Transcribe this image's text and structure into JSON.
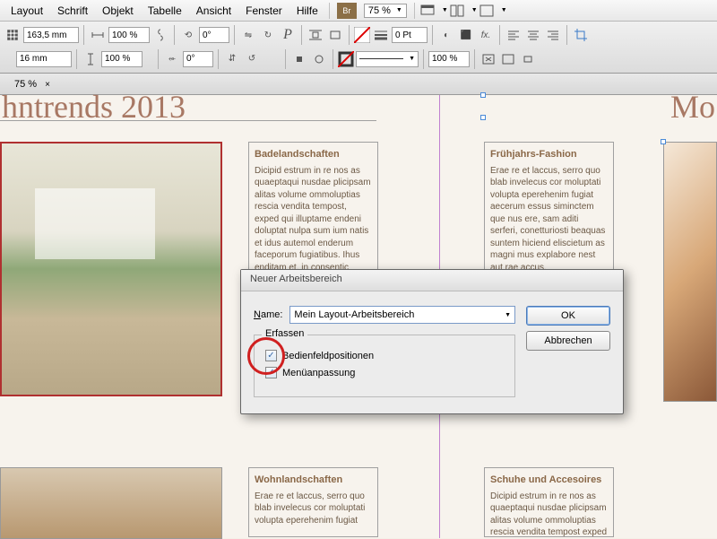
{
  "menubar": {
    "items": [
      "Layout",
      "Schrift",
      "Objekt",
      "Tabelle",
      "Ansicht",
      "Fenster",
      "Hilfe"
    ],
    "br_label": "Br",
    "zoom": "75 %"
  },
  "toolbar": {
    "x_field": "163,5 mm",
    "y_field": "16 mm",
    "pct_a": "100 %",
    "pct_b": "100 %",
    "deg_a": "0°",
    "deg_b": "0°",
    "p_icon": "P",
    "stroke_pt": "0 Pt",
    "fx_label": "fx.",
    "pct_c": "100 %",
    "pct_d": "100 %"
  },
  "tabs": {
    "zoom_tab": "75 %"
  },
  "canvas": {
    "title_left": "hntrends 2013",
    "title_right": "Mo",
    "blocks": {
      "bade": {
        "heading": "Badelandschaften",
        "body": "Dicipid estrum in re nos as quaeptaqui nusdae plicipsam alitas volume ommoluptias rescia vendita tempost, exped qui illuptame endeni doluptat nulpa sum ium natis et idus autemol enderum faceporum fugiatibus.\nIhus enditam et, in consentic"
      },
      "fruh": {
        "heading": "Frühjahrs-Fashion",
        "body": "Erae re et laccus, serro quo blab invelecus cor moluptati volupta eperehenim fugiat aecerum essus siminctem que nus ere, sam aditi serferi, conetturiosti beaquas suntem hiciend eliscietum as magni mus explabore nest aut rae accus."
      },
      "wohn": {
        "heading": "Wohnlandschaften",
        "body": "Erae re et laccus, serro quo blab invelecus cor moluptati volupta eperehenim fugiat"
      },
      "schuhe": {
        "heading": "Schuhe und Accesoires",
        "body": "Dicipid estrum in re nos as quaeptaqui nusdae plicipsam alitas volume ommoluptias rescia vendita tempost exped"
      }
    }
  },
  "dialog": {
    "title": "Neuer Arbeitsbereich",
    "name_label": "Name:",
    "name_value": "Mein Layout-Arbeitsbereich",
    "fieldset_legend": "Erfassen",
    "chk1": "Bedienfeldpositionen",
    "chk2": "Menüanpassung",
    "ok": "OK",
    "cancel": "Abbrechen"
  }
}
